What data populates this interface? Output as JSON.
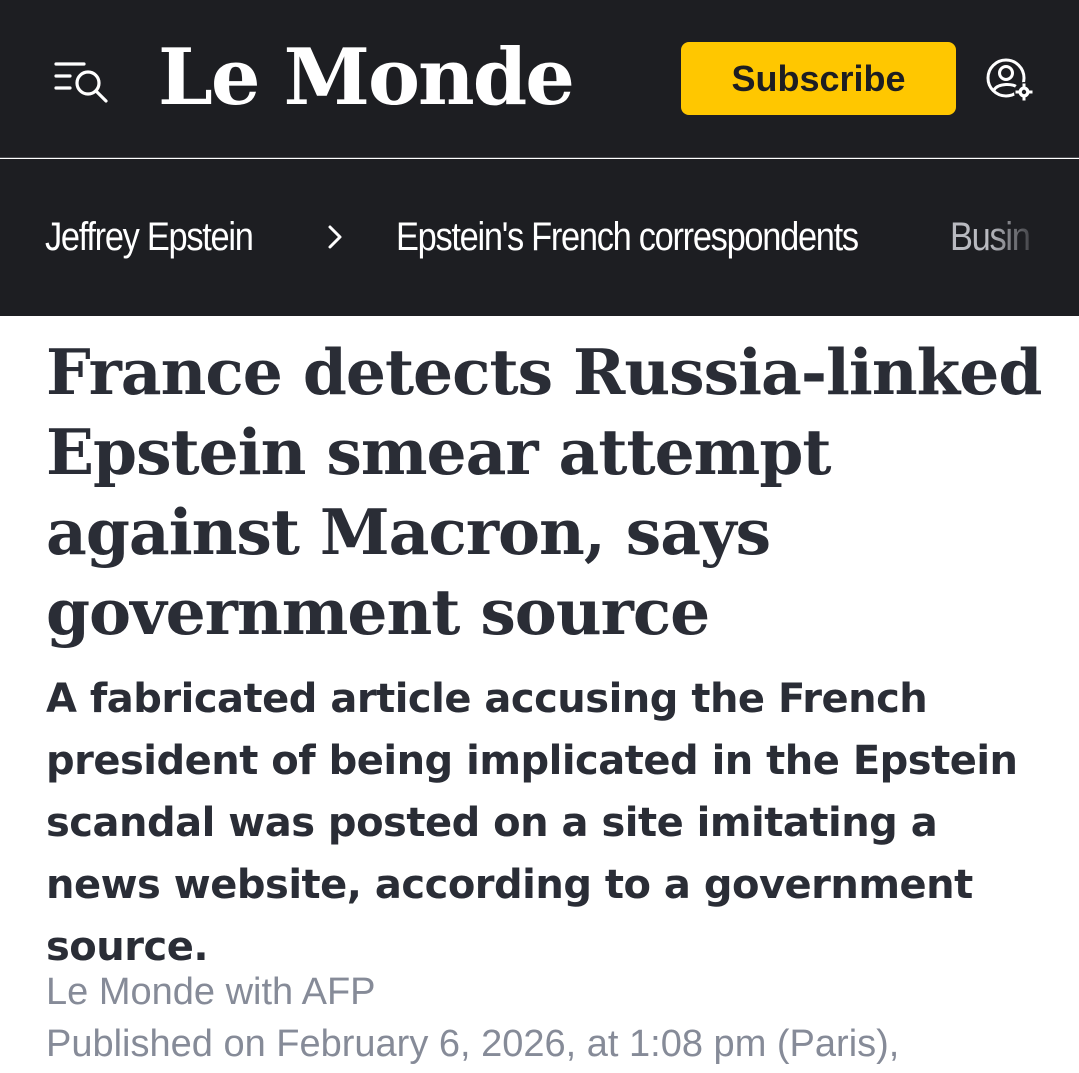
{
  "header": {
    "logo_text": "Le Monde",
    "subscribe_label": "Subscribe",
    "menu_icon": "menu-search-icon",
    "account_icon": "account-settings-icon",
    "colors": {
      "bar": "#1d1e22",
      "subscribe": "#ffc700"
    }
  },
  "breadcrumbs": {
    "items": [
      {
        "label": "Jeffrey Epstein"
      },
      {
        "label": "Epstein's French correspondents"
      },
      {
        "label": "Busin"
      }
    ],
    "separator_icon": "chevron-right-icon"
  },
  "article": {
    "headline": "France detects Russia-linked Epstein smear attempt against Macron, says government source",
    "dek": "A fabricated article accusing the French president of being implicated in the Epstein scandal was posted on a site imitating a news website, according to a government source.",
    "byline": "Le Monde with AFP",
    "published": "Published on February 6, 2026, at 1:08 pm (Paris),"
  }
}
